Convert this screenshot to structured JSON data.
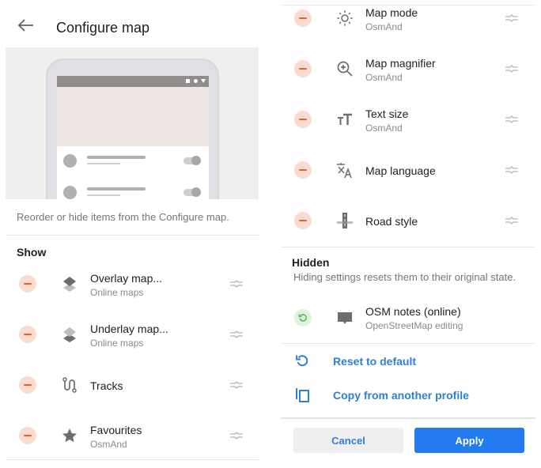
{
  "header": {
    "title": "Configure map",
    "back_icon": "arrow-left-icon"
  },
  "illustration": {
    "status_icons": [
      "square-icon",
      "circle-icon",
      "triangle-icon"
    ]
  },
  "description": "Reorder or hide items from the Configure map.",
  "show_section": {
    "title": "Show",
    "items": [
      {
        "label": "Overlay map...",
        "sublabel": "Online maps",
        "icon": "layers-top-icon"
      },
      {
        "label": "Underlay map...",
        "sublabel": "Online maps",
        "icon": "layers-bottom-icon"
      },
      {
        "label": "Tracks",
        "sublabel": "",
        "icon": "route-icon"
      },
      {
        "label": "Favourites",
        "sublabel": "OsmAnd",
        "icon": "star-icon"
      },
      {
        "label": "Map mode",
        "sublabel": "OsmAnd",
        "icon": "sun-icon"
      },
      {
        "label": "Map magnifier",
        "sublabel": "OsmAnd",
        "icon": "zoom-in-icon"
      },
      {
        "label": "Text size",
        "sublabel": "OsmAnd",
        "icon": "text-size-icon"
      },
      {
        "label": "Map language",
        "sublabel": "",
        "icon": "translate-icon"
      },
      {
        "label": "Road style",
        "sublabel": "",
        "icon": "road-icon"
      }
    ]
  },
  "hidden_section": {
    "title": "Hidden",
    "description": "Hiding settings resets them to their original state.",
    "items": [
      {
        "label": "OSM notes (online)",
        "sublabel": "OpenStreetMap editing",
        "icon": "comment-icon"
      }
    ]
  },
  "actions": [
    {
      "label": "Reset to default",
      "icon": "reset-icon"
    },
    {
      "label": "Copy from another profile",
      "icon": "copy-icon"
    }
  ],
  "footer": {
    "cancel_label": "Cancel",
    "apply_label": "Apply"
  },
  "colors": {
    "accent": "#237bef",
    "link": "#2d7fd8",
    "remove": "#e5602c",
    "remove_bg": "#fadbd0",
    "restore": "#5cb85c",
    "restore_bg": "#dff3dc"
  }
}
